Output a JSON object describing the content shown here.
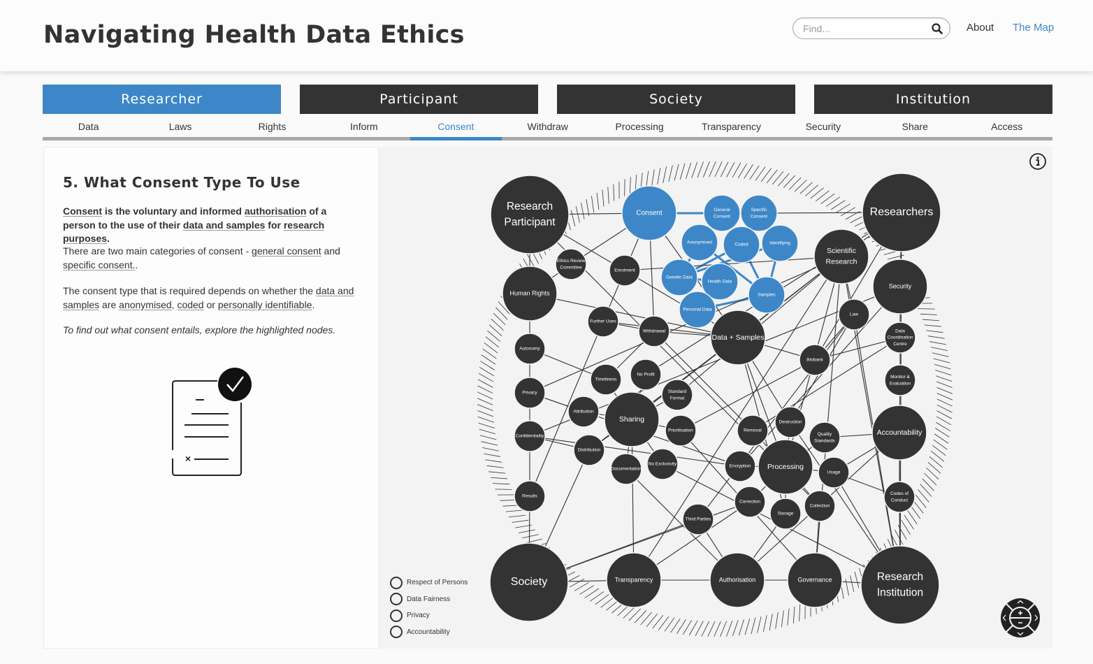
{
  "header": {
    "title": "Navigating Health Data Ethics",
    "search_placeholder": "Find...",
    "search_value": "",
    "nav": {
      "about": "About",
      "the_map": "The Map"
    },
    "accent_color": "#3d87c8"
  },
  "categories": [
    {
      "label": "Researcher",
      "active": true
    },
    {
      "label": "Participant",
      "active": false
    },
    {
      "label": "Society",
      "active": false
    },
    {
      "label": "Institution",
      "active": false
    }
  ],
  "sub_tabs": [
    {
      "label": "Data"
    },
    {
      "label": "Laws"
    },
    {
      "label": "Rights"
    },
    {
      "label": "Inform"
    },
    {
      "label": "Consent",
      "active": true
    },
    {
      "label": "Withdraw"
    },
    {
      "label": "Processing"
    },
    {
      "label": "Transparency"
    },
    {
      "label": "Security"
    },
    {
      "label": "Share"
    },
    {
      "label": "Access"
    }
  ],
  "content": {
    "title": "5. What Consent Type To Use",
    "p1": {
      "w1": "Consent",
      "t1": " is the voluntary and informed ",
      "w2": "authorisation",
      "t2": " of a person to the use of their ",
      "w3": "data and samples",
      "t3": " for ",
      "w4": "research purposes",
      "t4": "."
    },
    "p2": {
      "t1": "There are two main categories of consent - ",
      "w1": "general consent",
      "t2": " and ",
      "w2": "specific consent.",
      "t3": "."
    },
    "p3": {
      "t1": "The consent type that is required depends on whether the ",
      "w1": "data and samples",
      "t2": " are ",
      "w2": "anonymised",
      "t3": ", ",
      "w3": "coded",
      "t4": " or ",
      "w4": "personally identifiable",
      "t5": "."
    },
    "p4": "To find out what consent entails, explore the highlighted nodes."
  },
  "legend": [
    {
      "label": "Respect of Persons"
    },
    {
      "label": "Data Fairness"
    },
    {
      "label": "Privacy"
    },
    {
      "label": "Accountability"
    }
  ],
  "graph": {
    "node_color": "#333333",
    "highlight_color": "#3d87c8",
    "nodes": [
      {
        "id": "research-participant",
        "label": "Research|Participant",
        "size": "xl"
      },
      {
        "id": "researchers",
        "label": "Researchers",
        "size": "xl"
      },
      {
        "id": "society",
        "label": "Society",
        "size": "xl"
      },
      {
        "id": "research-institution",
        "label": "Research|Institution",
        "size": "xl"
      },
      {
        "id": "consent",
        "label": "Consent",
        "size": "l",
        "highlight": true
      },
      {
        "id": "general-consent",
        "label": "General|Consent",
        "size": "s",
        "highlight": true
      },
      {
        "id": "specific-consent",
        "label": "Specific|Consent",
        "size": "s",
        "highlight": true
      },
      {
        "id": "anonymised",
        "label": "Anonymised",
        "size": "s",
        "highlight": true
      },
      {
        "id": "coded",
        "label": "Coded",
        "size": "s",
        "highlight": true
      },
      {
        "id": "identifying",
        "label": "Identifying",
        "size": "s",
        "highlight": true
      },
      {
        "id": "genetic-data",
        "label": "Genetic Data",
        "size": "s",
        "highlight": true
      },
      {
        "id": "health-data",
        "label": "Health Data",
        "size": "s",
        "highlight": true
      },
      {
        "id": "samples",
        "label": "Samples",
        "size": "s",
        "highlight": true
      },
      {
        "id": "personal-data",
        "label": "Personal Data",
        "size": "s",
        "highlight": true
      },
      {
        "id": "human-rights",
        "label": "Human Rights",
        "size": "m"
      },
      {
        "id": "ethics-review-committee",
        "label": "Ethics Review|Committee",
        "size": "xs"
      },
      {
        "id": "enrolment",
        "label": "Enrolment",
        "size": "xs"
      },
      {
        "id": "further-uses",
        "label": "Further Uses",
        "size": "xs"
      },
      {
        "id": "withdrawal",
        "label": "Withdrawal",
        "size": "xs"
      },
      {
        "id": "data-samples",
        "label": "Data + Samples",
        "size": "m"
      },
      {
        "id": "scientific-research",
        "label": "Scientific|Research",
        "size": "m"
      },
      {
        "id": "security",
        "label": "Security",
        "size": "m"
      },
      {
        "id": "law",
        "label": "Law",
        "size": "xs"
      },
      {
        "id": "data-coordination-centre",
        "label": "Data|Coordination|Centre",
        "size": "xs"
      },
      {
        "id": "biobank",
        "label": "Biobank",
        "size": "xs"
      },
      {
        "id": "monitor-evaluation",
        "label": "Monitor &|Evaluation",
        "size": "xs"
      },
      {
        "id": "autonomy",
        "label": "Autonomy",
        "size": "xs"
      },
      {
        "id": "privacy",
        "label": "Privacy",
        "size": "xs"
      },
      {
        "id": "confidentiality",
        "label": "Confidentiality",
        "size": "xs"
      },
      {
        "id": "results",
        "label": "Results",
        "size": "xs"
      },
      {
        "id": "timeliness",
        "label": "Timeliness",
        "size": "xs"
      },
      {
        "id": "no-profit",
        "label": "No Profit",
        "size": "xs"
      },
      {
        "id": "standard-format",
        "label": "Standard|Format",
        "size": "xs"
      },
      {
        "id": "attribution",
        "label": "Attribution",
        "size": "xs"
      },
      {
        "id": "sharing",
        "label": "Sharing",
        "size": "m"
      },
      {
        "id": "prioritisation",
        "label": "Prioritisation",
        "size": "xs"
      },
      {
        "id": "distribution",
        "label": "Distribution",
        "size": "xs"
      },
      {
        "id": "documentation",
        "label": "Documentation",
        "size": "xs"
      },
      {
        "id": "no-exclusivity",
        "label": "No Exclusivity",
        "size": "xs"
      },
      {
        "id": "removal",
        "label": "Removal",
        "size": "xs"
      },
      {
        "id": "destruction",
        "label": "Destruction",
        "size": "xs"
      },
      {
        "id": "quality-standards",
        "label": "Quality|Standards",
        "size": "xs"
      },
      {
        "id": "accountability",
        "label": "Accountability",
        "size": "m"
      },
      {
        "id": "encryption",
        "label": "Encryption",
        "size": "xs"
      },
      {
        "id": "processing",
        "label": "Processing",
        "size": "m"
      },
      {
        "id": "usage",
        "label": "Usage",
        "size": "xs"
      },
      {
        "id": "codes-of-conduct",
        "label": "Codes of|Conduct",
        "size": "xs"
      },
      {
        "id": "correction",
        "label": "Correction",
        "size": "xs"
      },
      {
        "id": "storage",
        "label": "Storage",
        "size": "xs"
      },
      {
        "id": "collection",
        "label": "Collection",
        "size": "xs"
      },
      {
        "id": "third-parties",
        "label": "Third Parties",
        "size": "xs"
      },
      {
        "id": "transparency",
        "label": "Transparency",
        "size": "m"
      },
      {
        "id": "authorisation",
        "label": "Authorisation",
        "size": "m"
      },
      {
        "id": "governance",
        "label": "Governance",
        "size": "m"
      }
    ],
    "edges": [
      [
        "research-participant",
        "consent"
      ],
      [
        "research-participant",
        "human-rights"
      ],
      [
        "research-participant",
        "enrolment"
      ],
      [
        "consent",
        "general-consent"
      ],
      [
        "general-consent",
        "specific-consent"
      ],
      [
        "specific-consent",
        "researchers"
      ],
      [
        "general-consent",
        "anonymised"
      ],
      [
        "general-consent",
        "coded"
      ],
      [
        "specific-consent",
        "identifying"
      ],
      [
        "anonymised",
        "genetic-data"
      ],
      [
        "anonymised",
        "samples"
      ],
      [
        "coded",
        "genetic-data"
      ],
      [
        "coded",
        "samples"
      ],
      [
        "identifying",
        "samples"
      ],
      [
        "identifying",
        "genetic-data"
      ],
      [
        "genetic-data",
        "personal-data"
      ],
      [
        "health-data",
        "personal-data"
      ],
      [
        "samples",
        "personal-data"
      ],
      [
        "genetic-data",
        "health-data"
      ],
      [
        "consent",
        "enrolment"
      ],
      [
        "consent",
        "withdrawal"
      ],
      [
        "consent",
        "data-samples"
      ],
      [
        "consent",
        "ethics-review-committee"
      ],
      [
        "human-rights",
        "ethics-review-committee"
      ],
      [
        "human-rights",
        "autonomy"
      ],
      [
        "human-rights",
        "data-samples"
      ],
      [
        "autonomy",
        "privacy"
      ],
      [
        "privacy",
        "confidentiality"
      ],
      [
        "confidentiality",
        "results"
      ],
      [
        "results",
        "society"
      ],
      [
        "enrolment",
        "further-uses"
      ],
      [
        "enrolment",
        "data-samples"
      ],
      [
        "enrolment",
        "scientific-research"
      ],
      [
        "further-uses",
        "withdrawal"
      ],
      [
        "further-uses",
        "data-samples"
      ],
      [
        "further-uses",
        "results"
      ],
      [
        "withdrawal",
        "data-samples"
      ],
      [
        "withdrawal",
        "removal"
      ],
      [
        "withdrawal",
        "timeliness"
      ],
      [
        "data-samples",
        "scientific-research"
      ],
      [
        "data-samples",
        "biobank"
      ],
      [
        "data-samples",
        "processing"
      ],
      [
        "data-samples",
        "sharing"
      ],
      [
        "data-samples",
        "destruction"
      ],
      [
        "data-samples",
        "storage"
      ],
      [
        "data-samples",
        "distribution"
      ],
      [
        "researchers",
        "scientific-research"
      ],
      [
        "researchers",
        "security"
      ],
      [
        "researchers",
        "biobank"
      ],
      [
        "security",
        "data-coordination-centre"
      ],
      [
        "data-coordination-centre",
        "monitor-evaluation"
      ],
      [
        "monitor-evaluation",
        "accountability"
      ],
      [
        "accountability",
        "codes-of-conduct"
      ],
      [
        "codes-of-conduct",
        "research-institution"
      ],
      [
        "scientific-research",
        "law"
      ],
      [
        "scientific-research",
        "privacy"
      ],
      [
        "scientific-research",
        "sharing"
      ],
      [
        "scientific-research",
        "processing"
      ],
      [
        "law",
        "biobank"
      ],
      [
        "law",
        "destruction"
      ],
      [
        "law",
        "third-parties"
      ],
      [
        "law",
        "research-institution"
      ],
      [
        "biobank",
        "data-coordination-centre"
      ],
      [
        "biobank",
        "prioritisation"
      ],
      [
        "sharing",
        "timeliness"
      ],
      [
        "sharing",
        "no-profit"
      ],
      [
        "sharing",
        "standard-format"
      ],
      [
        "sharing",
        "attribution"
      ],
      [
        "sharing",
        "prioritisation"
      ],
      [
        "sharing",
        "distribution"
      ],
      [
        "sharing",
        "documentation"
      ],
      [
        "sharing",
        "no-exclusivity"
      ],
      [
        "sharing",
        "transparency"
      ],
      [
        "attribution",
        "privacy"
      ],
      [
        "distribution",
        "confidentiality"
      ],
      [
        "distribution",
        "society"
      ],
      [
        "documentation",
        "authorisation"
      ],
      [
        "no-exclusivity",
        "research-institution"
      ],
      [
        "prioritisation",
        "governance"
      ],
      [
        "processing",
        "removal"
      ],
      [
        "processing",
        "destruction"
      ],
      [
        "processing",
        "quality-standards"
      ],
      [
        "processing",
        "encryption"
      ],
      [
        "processing",
        "usage"
      ],
      [
        "processing",
        "correction"
      ],
      [
        "processing",
        "storage"
      ],
      [
        "processing",
        "collection"
      ],
      [
        "usage",
        "accountability"
      ],
      [
        "usage",
        "codes-of-conduct"
      ],
      [
        "quality-standards",
        "accountability"
      ],
      [
        "collection",
        "governance"
      ],
      [
        "storage",
        "authorisation"
      ],
      [
        "correction",
        "transparency"
      ],
      [
        "third-parties",
        "society"
      ],
      [
        "encryption",
        "privacy"
      ],
      [
        "correction",
        "society"
      ],
      [
        "society",
        "transparency"
      ],
      [
        "transparency",
        "authorisation"
      ],
      [
        "authorisation",
        "governance"
      ],
      [
        "governance",
        "research-institution"
      ],
      [
        "research-institution",
        "accountability"
      ],
      [
        "research-institution",
        "scientific-research"
      ],
      [
        "research-institution",
        "researchers"
      ],
      [
        "security",
        "encryption"
      ],
      [
        "security",
        "confidentiality"
      ],
      [
        "confidentiality",
        "encryption"
      ],
      [
        "standard-format",
        "scientific-research"
      ],
      [
        "timeliness",
        "autonomy"
      ],
      [
        "no-profit",
        "researchers"
      ],
      [
        "destruction",
        "research-institution"
      ],
      [
        "usage",
        "research-institution"
      ],
      [
        "collection",
        "research-participant"
      ],
      [
        "third-parties",
        "authorisation"
      ],
      [
        "removal",
        "data-coordination-centre"
      ],
      [
        "transparency",
        "scientific-research"
      ],
      [
        "governance",
        "scientific-research"
      ],
      [
        "authorisation",
        "accountability"
      ]
    ]
  }
}
